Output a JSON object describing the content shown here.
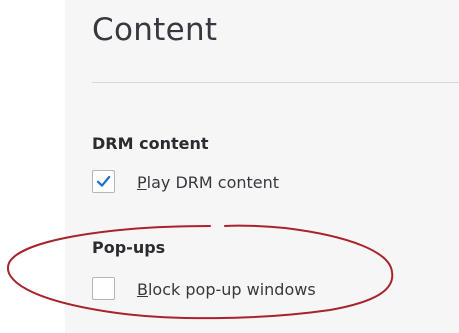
{
  "page": {
    "title": "Content"
  },
  "drm": {
    "heading": "DRM content",
    "checkbox_checked": true,
    "label_accesskey": "P",
    "label_rest": "lay DRM content"
  },
  "popups": {
    "heading": "Pop-ups",
    "checkbox_checked": false,
    "label_accesskey": "B",
    "label_rest": "lock pop-up windows"
  },
  "annotation": {
    "highlight_color": "#a8232b",
    "highlight_target": "popups"
  },
  "icons": {
    "drm_checkbox": "checkmark-icon"
  },
  "colors": {
    "checkmark": "#1f6fd1",
    "panel_background": "#f6f6f7"
  }
}
